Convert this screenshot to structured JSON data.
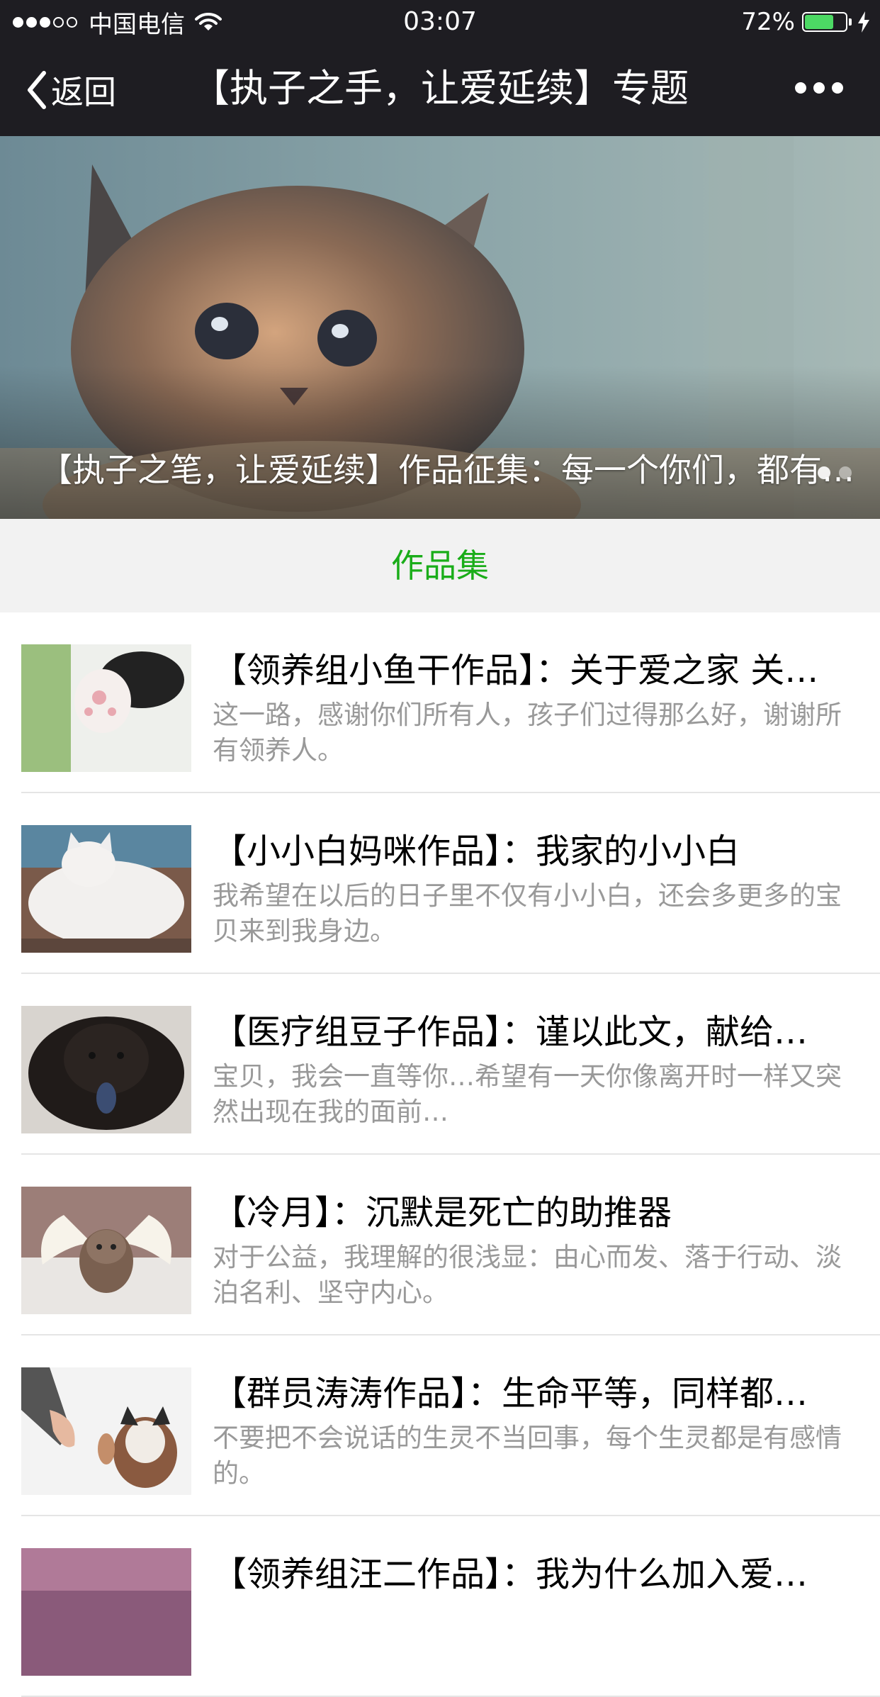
{
  "status_bar": {
    "carrier": "中国电信",
    "time": "03:07",
    "battery": "72%",
    "battery_level": 0.72,
    "signal_bars": 3
  },
  "nav": {
    "back_label": "返回",
    "title": "【执子之手，让爱延续】专题"
  },
  "banner": {
    "caption": "【执子之笔，让爱延续】作品征集：每一个你们，都有…",
    "page_count": 2,
    "active_page": 1
  },
  "section": {
    "title": "作品集"
  },
  "articles": [
    {
      "title": "【领养组小鱼干作品】：关于爱之家 关…",
      "desc": "这一路，感谢你们所有人，孩子们过得那么好，谢谢所有领养人。"
    },
    {
      "title": "【小小白妈咪作品】：我家的小小白",
      "desc": "我希望在以后的日子里不仅有小小白，还会多更多的宝贝来到我身边。"
    },
    {
      "title": "【医疗组豆子作品】：谨以此文，献给…",
      "desc": "宝贝，我会一直等你…希望有一天你像离开时一样又突然出现在我的面前…"
    },
    {
      "title": "【冷月】：沉默是死亡的助推器",
      "desc": "对于公益，我理解的很浅显：由心而发、落于行动、淡泊名利、坚守内心。"
    },
    {
      "title": "【群员涛涛作品】：生命平等，同样都…",
      "desc": "不要把不会说话的生灵不当回事，每个生灵都是有感情的。"
    },
    {
      "title": "【领养组汪二作品】：我为什么加入爱…",
      "desc": ""
    }
  ],
  "colors": {
    "bar_bg": "#1e1d22",
    "accent_green": "#1aad19",
    "battery_green": "#4cd964",
    "desc_gray": "#999999"
  }
}
